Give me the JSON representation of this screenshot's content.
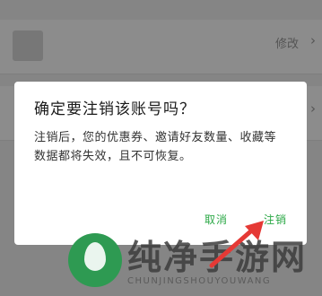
{
  "background": {
    "edit_label": "修改",
    "chevron": "›"
  },
  "dialog": {
    "title": "确定要注销该账号吗？",
    "message": "注销后，您的优惠券、邀请好友数量、收藏等数据都将失效，且不可恢复。",
    "cancel_label": "取消",
    "confirm_label": "注销",
    "accent_color": "#2aa845"
  },
  "watermark": {
    "text": "纯净手游网",
    "subtext": "CHUNJINGSHOUYOUWANG"
  },
  "annotation": {
    "arrow_color": "#e53935",
    "arrow_icon": "red-arrow-icon"
  }
}
